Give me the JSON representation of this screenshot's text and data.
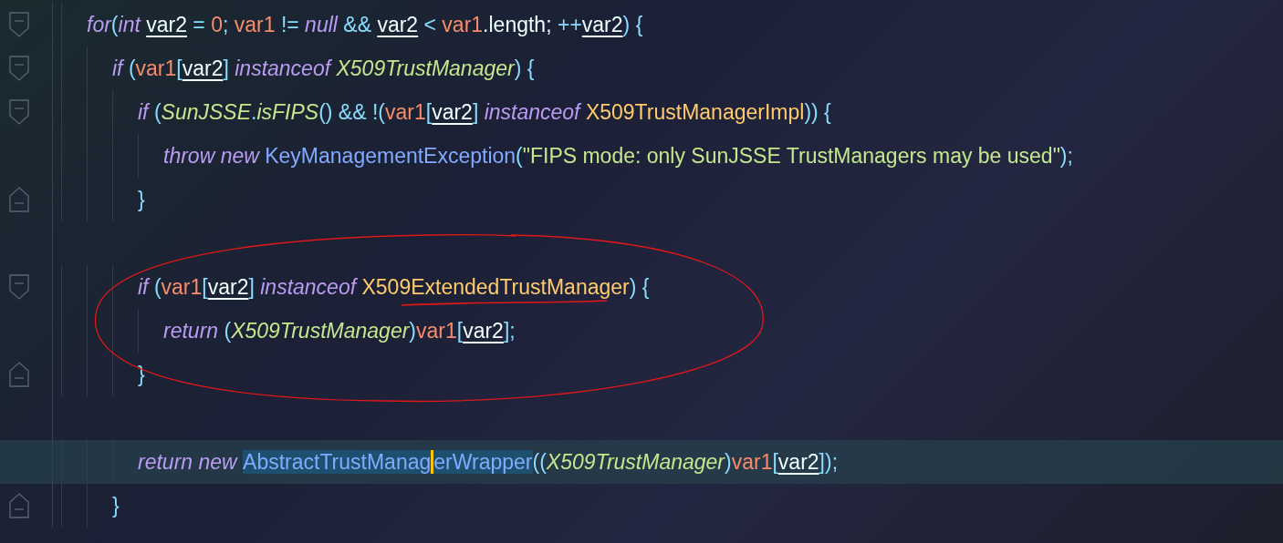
{
  "editor": {
    "lines": [
      {
        "kind": "code",
        "foldable": true,
        "block_end": false,
        "current": false,
        "tokens": [
          {
            "text": "for",
            "kind": "keyword"
          },
          {
            "text": "(",
            "kind": "punct"
          },
          {
            "text": "int ",
            "kind": "keyword"
          },
          {
            "text": "var2",
            "kind": "local"
          },
          {
            "text": " = ",
            "kind": "punct"
          },
          {
            "text": "0",
            "kind": "number"
          },
          {
            "text": "; ",
            "kind": "punct"
          },
          {
            "text": "var1",
            "kind": "param"
          },
          {
            "text": " != ",
            "kind": "punct"
          },
          {
            "text": "null",
            "kind": "keyword"
          },
          {
            "text": " && ",
            "kind": "punct"
          },
          {
            "text": "var2",
            "kind": "local"
          },
          {
            "text": " < ",
            "kind": "punct"
          },
          {
            "text": "var1",
            "kind": "param"
          },
          {
            "text": ".length; ",
            "kind": "field"
          },
          {
            "text": "++",
            "kind": "punct"
          },
          {
            "text": "var2",
            "kind": "local"
          },
          {
            "text": ") {",
            "kind": "punct"
          }
        ],
        "children": [
          {
            "kind": "code",
            "foldable": true,
            "block_end": false,
            "current": false,
            "tokens": [
              {
                "text": "if ",
                "kind": "keyword"
              },
              {
                "text": "(",
                "kind": "punct"
              },
              {
                "text": "var1",
                "kind": "param"
              },
              {
                "text": "[",
                "kind": "punct"
              },
              {
                "text": "var2",
                "kind": "local"
              },
              {
                "text": "] ",
                "kind": "punct"
              },
              {
                "text": "instanceof ",
                "kind": "keyword"
              },
              {
                "text": "X509TrustManager",
                "kind": "type"
              },
              {
                "text": ") {",
                "kind": "punct"
              }
            ],
            "children": [
              {
                "kind": "code",
                "foldable": true,
                "block_end": false,
                "current": false,
                "tokens": [
                  {
                    "text": "if ",
                    "kind": "keyword"
                  },
                  {
                    "text": "(",
                    "kind": "punct"
                  },
                  {
                    "text": "SunJSSE",
                    "kind": "type"
                  },
                  {
                    "text": ".",
                    "kind": "punct"
                  },
                  {
                    "text": "isFIPS",
                    "kind": "method"
                  },
                  {
                    "text": "() && !(",
                    "kind": "punct"
                  },
                  {
                    "text": "var1",
                    "kind": "param"
                  },
                  {
                    "text": "[",
                    "kind": "punct"
                  },
                  {
                    "text": "var2",
                    "kind": "local"
                  },
                  {
                    "text": "] ",
                    "kind": "punct"
                  },
                  {
                    "text": "instanceof ",
                    "kind": "keyword"
                  },
                  {
                    "text": "X509TrustManagerImpl",
                    "kind": "interface"
                  },
                  {
                    "text": ")) {",
                    "kind": "punct"
                  }
                ],
                "children": [
                  {
                    "kind": "code",
                    "foldable": false,
                    "block_end": false,
                    "current": false,
                    "tokens": [
                      {
                        "text": "throw new ",
                        "kind": "keyword"
                      },
                      {
                        "text": "KeyManagementException",
                        "kind": "class"
                      },
                      {
                        "text": "(",
                        "kind": "punct"
                      },
                      {
                        "text": "\"FIPS mode: only SunJSSE TrustManagers may be used\"",
                        "kind": "string"
                      },
                      {
                        "text": ");",
                        "kind": "punct"
                      }
                    ]
                  }
                ]
              },
              {
                "kind": "code",
                "foldable": false,
                "block_end": true,
                "current": false,
                "tokens": [
                  {
                    "text": "}",
                    "kind": "punct"
                  }
                ]
              },
              {
                "kind": "blank"
              },
              {
                "kind": "code",
                "foldable": true,
                "block_end": false,
                "current": false,
                "tokens": [
                  {
                    "text": "if ",
                    "kind": "keyword"
                  },
                  {
                    "text": "(",
                    "kind": "punct"
                  },
                  {
                    "text": "var1",
                    "kind": "param"
                  },
                  {
                    "text": "[",
                    "kind": "punct"
                  },
                  {
                    "text": "var2",
                    "kind": "local"
                  },
                  {
                    "text": "] ",
                    "kind": "punct"
                  },
                  {
                    "text": "instanceof ",
                    "kind": "keyword"
                  },
                  {
                    "text": "X509ExtendedTrustManager",
                    "kind": "interface"
                  },
                  {
                    "text": ") {",
                    "kind": "punct"
                  }
                ],
                "children": [
                  {
                    "kind": "code",
                    "foldable": false,
                    "block_end": false,
                    "current": false,
                    "tokens": [
                      {
                        "text": "return ",
                        "kind": "keyword"
                      },
                      {
                        "text": "(",
                        "kind": "punct"
                      },
                      {
                        "text": "X509TrustManager",
                        "kind": "type"
                      },
                      {
                        "text": ")",
                        "kind": "punct"
                      },
                      {
                        "text": "var1",
                        "kind": "param"
                      },
                      {
                        "text": "[",
                        "kind": "punct"
                      },
                      {
                        "text": "var2",
                        "kind": "local"
                      },
                      {
                        "text": "];",
                        "kind": "punct"
                      }
                    ]
                  }
                ]
              },
              {
                "kind": "code",
                "foldable": false,
                "block_end": true,
                "current": false,
                "tokens": [
                  {
                    "text": "}",
                    "kind": "punct"
                  }
                ]
              },
              {
                "kind": "blank"
              },
              {
                "kind": "code",
                "foldable": false,
                "block_end": false,
                "current": true,
                "tokens": [
                  {
                    "text": "return new ",
                    "kind": "keyword"
                  },
                  {
                    "text": "AbstractTrustManag",
                    "kind": "class_selected"
                  },
                  {
                    "text": "erWrapper",
                    "kind": "class_selected",
                    "caret_before": true
                  },
                  {
                    "text": "((",
                    "kind": "punct"
                  },
                  {
                    "text": "X509TrustManager",
                    "kind": "type"
                  },
                  {
                    "text": ")",
                    "kind": "punct"
                  },
                  {
                    "text": "var1",
                    "kind": "param"
                  },
                  {
                    "text": "[",
                    "kind": "punct"
                  },
                  {
                    "text": "var2",
                    "kind": "local"
                  },
                  {
                    "text": "]);",
                    "kind": "punct"
                  }
                ]
              }
            ]
          },
          {
            "kind": "code",
            "foldable": false,
            "block_end": true,
            "current": false,
            "tokens": [
              {
                "text": "}",
                "kind": "punct"
              }
            ]
          }
        ]
      }
    ]
  }
}
